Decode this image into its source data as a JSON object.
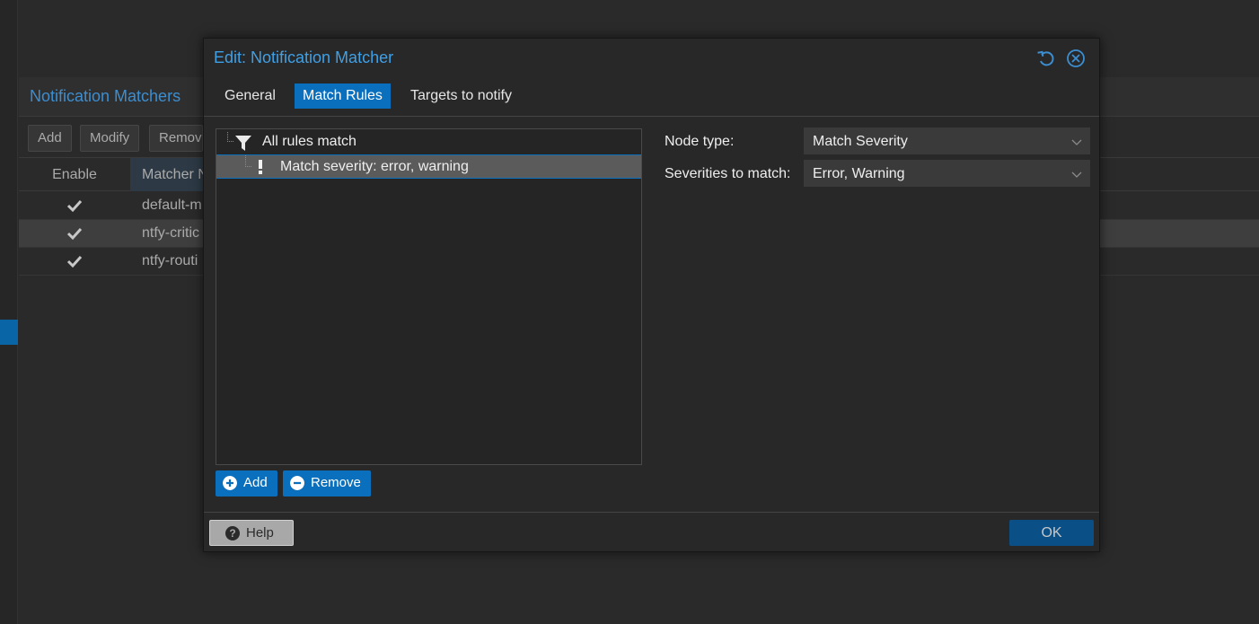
{
  "background": {
    "panel_title": "Notification Matchers",
    "toolbar": {
      "add": "Add",
      "modify": "Modify",
      "remove": "Remov"
    },
    "columns": {
      "enable": "Enable",
      "name": "Matcher N"
    },
    "rows": [
      {
        "enabled": true,
        "name": "default-m"
      },
      {
        "enabled": true,
        "name": "ntfy-critic"
      },
      {
        "enabled": true,
        "name": "ntfy-routi"
      }
    ]
  },
  "dialog": {
    "title": "Edit: Notification Matcher",
    "tabs": [
      {
        "label": "General",
        "active": false
      },
      {
        "label": "Match Rules",
        "active": true
      },
      {
        "label": "Targets to notify",
        "active": false
      }
    ],
    "tree": {
      "root_label": "All rules match",
      "root_icon": "filter-icon",
      "children": [
        {
          "label": "Match severity: error, warning",
          "icon": "exclamation-icon",
          "selected": true
        }
      ]
    },
    "add_label": "Add",
    "remove_label": "Remove",
    "form": {
      "node_type_label": "Node type:",
      "node_type_value": "Match Severity",
      "severities_label": "Severities to match:",
      "severities_value": "Error, Warning"
    },
    "help_label": "Help",
    "ok_label": "OK"
  },
  "colors": {
    "accent": "#0a6fbd",
    "title_blue": "#3fa0e6",
    "background": "#2a2a2a"
  }
}
